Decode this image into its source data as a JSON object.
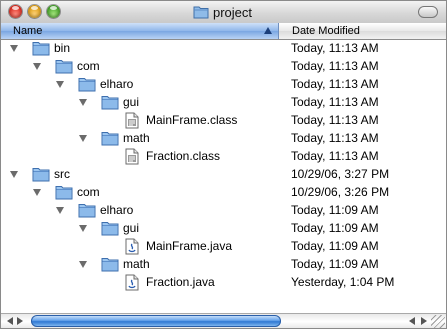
{
  "window": {
    "title": "project"
  },
  "header": {
    "name_label": "Name",
    "date_label": "Date Modified"
  },
  "rows": [
    {
      "name": "bin",
      "date": "Today, 11:13 AM",
      "depth": 0,
      "kind": "folder",
      "expanded": true
    },
    {
      "name": "com",
      "date": "Today, 11:13 AM",
      "depth": 1,
      "kind": "folder",
      "expanded": true
    },
    {
      "name": "elharo",
      "date": "Today, 11:13 AM",
      "depth": 2,
      "kind": "folder",
      "expanded": true
    },
    {
      "name": "gui",
      "date": "Today, 11:13 AM",
      "depth": 3,
      "kind": "folder",
      "expanded": true
    },
    {
      "name": "MainFrame.class",
      "date": "Today, 11:13 AM",
      "depth": 4,
      "kind": "class-file"
    },
    {
      "name": "math",
      "date": "Today, 11:13 AM",
      "depth": 3,
      "kind": "folder",
      "expanded": true
    },
    {
      "name": "Fraction.class",
      "date": "Today, 11:13 AM",
      "depth": 4,
      "kind": "class-file"
    },
    {
      "name": "src",
      "date": "10/29/06, 3:27 PM",
      "depth": 0,
      "kind": "folder",
      "expanded": true
    },
    {
      "name": "com",
      "date": "10/29/06, 3:26 PM",
      "depth": 1,
      "kind": "folder",
      "expanded": true
    },
    {
      "name": "elharo",
      "date": "Today, 11:09 AM",
      "depth": 2,
      "kind": "folder",
      "expanded": true
    },
    {
      "name": "gui",
      "date": "Today, 11:09 AM",
      "depth": 3,
      "kind": "folder",
      "expanded": true
    },
    {
      "name": "MainFrame.java",
      "date": "Today, 11:09 AM",
      "depth": 4,
      "kind": "java-file"
    },
    {
      "name": "math",
      "date": "Today, 11:09 AM",
      "depth": 3,
      "kind": "folder",
      "expanded": true
    },
    {
      "name": "Fraction.java",
      "date": "Yesterday, 1:04 PM",
      "depth": 4,
      "kind": "java-file"
    }
  ],
  "scrollbar": {
    "horizontal_position": 0.0
  }
}
